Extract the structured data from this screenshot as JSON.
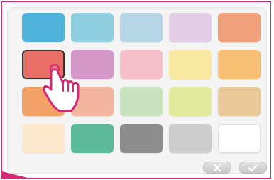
{
  "palette": {
    "rows": [
      [
        "#4fb3dc",
        "#90cfe0",
        "#b6d6e6",
        "#e3cde6",
        "#f0a07a"
      ],
      [
        "#e86f66",
        "#d596c8",
        "#f6c0cb",
        "#f9e8a0",
        "#f7bf73"
      ],
      [
        "#f2a266",
        "#f3b5a0",
        "#c9e3be",
        "#e1e99c",
        "#e9c897"
      ],
      [
        "#fde7cd",
        "#5cb99a",
        "#8d8d8d",
        "#cccccc",
        "#ffffff"
      ]
    ],
    "selected": {
      "row": 1,
      "col": 0
    }
  },
  "buttons": {
    "cancel_icon": "close-icon",
    "ok_icon": "check-icon"
  },
  "colors": {
    "accent": "#d42a76",
    "selection_border": "#333333"
  }
}
